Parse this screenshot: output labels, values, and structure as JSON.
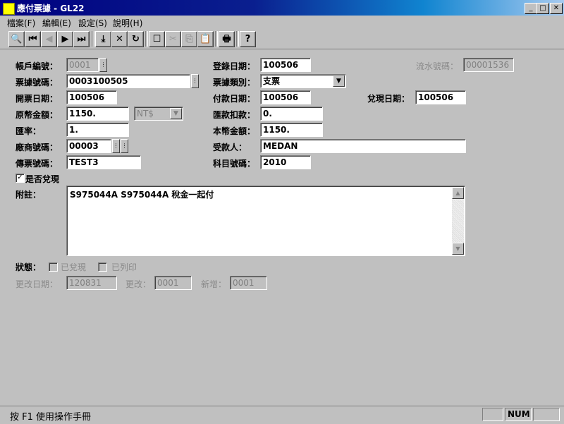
{
  "window": {
    "title": "應付票據 - GL22"
  },
  "menu": [
    "檔案(F)",
    "編輯(E)",
    "設定(S)",
    "說明(H)"
  ],
  "toolbar": {
    "buttons": [
      {
        "name": "search-icon",
        "glyph": "🔍"
      },
      {
        "name": "first-record-icon",
        "glyph": "⏮"
      },
      {
        "name": "prev-record-icon",
        "glyph": "◀"
      },
      {
        "name": "next-record-icon",
        "glyph": "▶"
      },
      {
        "name": "last-record-icon",
        "glyph": "⏭"
      },
      {
        "name": "save-icon",
        "glyph": "⤓"
      },
      {
        "name": "delete-icon",
        "glyph": "✕"
      },
      {
        "name": "refresh-icon",
        "glyph": "↻"
      },
      {
        "name": "new-icon",
        "glyph": "☐"
      },
      {
        "name": "cut-icon",
        "glyph": "✂"
      },
      {
        "name": "copy-icon",
        "glyph": "⎘"
      },
      {
        "name": "paste-icon",
        "glyph": "📋"
      },
      {
        "name": "print-icon",
        "glyph": "🖶"
      },
      {
        "name": "help-icon",
        "glyph": "?"
      }
    ]
  },
  "form": {
    "account_no": {
      "label": "帳戶編號：",
      "value": "0001"
    },
    "register_date": {
      "label": "登錄日期：",
      "value": "100506"
    },
    "serial_no": {
      "label": "流水號碼：",
      "value": "00001536"
    },
    "note_no": {
      "label": "票據號碼：",
      "value": "0003100505"
    },
    "note_type": {
      "label": "票據類別：",
      "value": "支票"
    },
    "issue_date": {
      "label": "開票日期：",
      "value": "100506"
    },
    "pay_date": {
      "label": "付款日期：",
      "value": "100506"
    },
    "cash_date": {
      "label": "兌現日期：",
      "value": "100506"
    },
    "orig_amount": {
      "label": "原幣金額：",
      "value": "1150."
    },
    "currency": {
      "value": "NT$"
    },
    "exchange_deduction": {
      "label": "匯款扣款：",
      "value": "0."
    },
    "exchange_rate": {
      "label": "匯率：",
      "value": "1."
    },
    "local_amount": {
      "label": "本幣金額：",
      "value": "1150."
    },
    "vendor_no": {
      "label": "廠商號碼：",
      "value": "00003"
    },
    "payee": {
      "label": "受款人：",
      "value": "MEDAN"
    },
    "voucher_no": {
      "label": "傳票號碼：",
      "value": "TEST3"
    },
    "account_code": {
      "label": "科目號碼：",
      "value": "2010"
    },
    "cashed_flag": {
      "label": "是否兌現",
      "checked": true
    },
    "memo": {
      "label": "附註：",
      "value": "S975044A S975044A 稅金一起付"
    },
    "status": {
      "label": "狀態：",
      "cashed": "已兌現",
      "printed": "已列印"
    },
    "modified_date": {
      "label": "更改日期：",
      "value": "120831"
    },
    "modified_by": {
      "label": "更改：",
      "value": "0001"
    },
    "created_by": {
      "label": "新增：",
      "value": "0001"
    }
  },
  "statusbar": {
    "help": "按 F1 使用操作手冊",
    "num": "NUM"
  }
}
